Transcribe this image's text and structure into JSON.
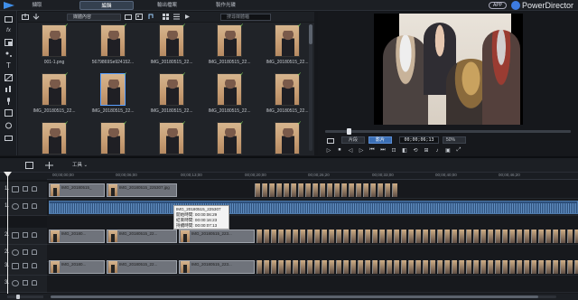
{
  "app": {
    "brand": "PowerDirector",
    "badge": "APP",
    "accent": "#3d7be0",
    "mode_tabs": [
      "擷取",
      "編輯",
      "輸出檔案",
      "製作光碟"
    ],
    "active_mode": "編輯"
  },
  "library": {
    "dropdown": "媒體內容",
    "search_placeholder": "搜尋媒體櫃",
    "items": [
      {
        "label": "001-1.png"
      },
      {
        "label": "5679869Se924152..."
      },
      {
        "label": "IMG_20180515_22..."
      },
      {
        "label": "IMG_20180515_22..."
      },
      {
        "label": "IMG_20180515_22..."
      },
      {
        "label": "IMG_20180515_22..."
      },
      {
        "label": "IMG_20180515_22..."
      },
      {
        "label": "IMG_20180515_22..."
      },
      {
        "label": "IMG_20180515_22..."
      },
      {
        "label": "IMG_20180515_22..."
      },
      {
        "label": ""
      },
      {
        "label": ""
      },
      {
        "label": ""
      },
      {
        "label": ""
      },
      {
        "label": ""
      }
    ]
  },
  "preview": {
    "mode_clip": "片段",
    "mode_movie": "影片",
    "timecode": "00;00;06;13",
    "zoom": "50%",
    "controls": [
      "▷",
      "⏹",
      "◁",
      "▷",
      "⏮",
      "⏭",
      "⊡",
      "◧",
      "⟲",
      "⊞",
      "♪",
      "▣",
      "⤢"
    ]
  },
  "edit_toolbar": {
    "tools_label": "工具"
  },
  "ruler": {
    "ticks": [
      "00;00;00;00",
      "00;00;06;00",
      "00;00;13;00",
      "00;00;20;00",
      "00;00;26;20",
      "00;00;33;00",
      "00;00;40;00",
      "00;00;46;20"
    ]
  },
  "tracks": [
    {
      "num": "1.",
      "kind": "video"
    },
    {
      "num": "1.",
      "kind": "audio"
    },
    {
      "num": "2.",
      "kind": "video"
    },
    {
      "num": "2.",
      "kind": "audio"
    },
    {
      "num": "3.",
      "kind": "video"
    },
    {
      "num": "3.",
      "kind": "audio"
    }
  ],
  "clips": {
    "generic": "IMG_20180515_22...",
    "track1_a": "IMG_20180515_",
    "track1_b": "IMG_20180515_225307.jpg",
    "track2_a": "IMG_20180...",
    "track2_b": "IMG_20180515_22...",
    "track2_c": "IMG_20180515_223..."
  },
  "tooltip": {
    "line1": "IMG_20180515_225307",
    "line2": "開始時間: 00:00:06:29",
    "line3": "結束時間: 00:00:16:23",
    "line4": "持續時間: 00:00:07:13"
  }
}
